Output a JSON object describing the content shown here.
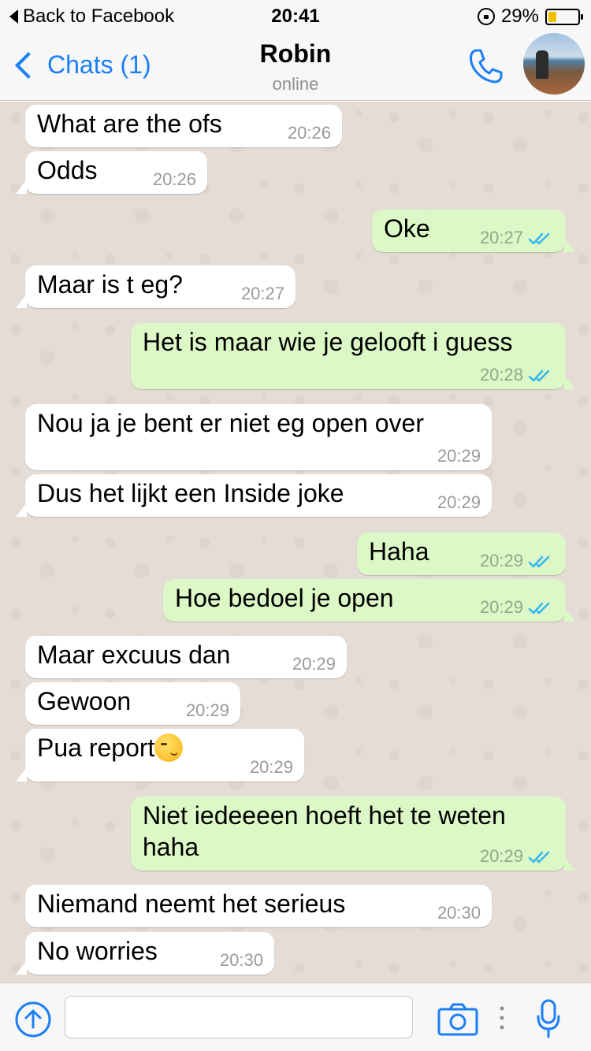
{
  "status_bar": {
    "back_app": "Back to Facebook",
    "time": "20:41",
    "battery": "29%",
    "battery_level": 0.29,
    "battery_color": "#f3c000"
  },
  "nav": {
    "back_label": "Chats (1)",
    "title": "Robin",
    "subtitle": "online",
    "accent": "#1b7ff7",
    "icons": [
      "chevron-left-icon",
      "phone-icon",
      "avatar"
    ]
  },
  "messages": [
    {
      "dir": "in",
      "text": "What are the ofs",
      "time": "20:26"
    },
    {
      "dir": "in",
      "text": "Odds",
      "time": "20:26"
    },
    {
      "dir": "out",
      "text": "Oke",
      "time": "20:27"
    },
    {
      "dir": "in",
      "text": "Maar is t eg?",
      "time": "20:27"
    },
    {
      "dir": "out",
      "text": "Het is maar wie je gelooft i guess",
      "time": "20:28"
    },
    {
      "dir": "in",
      "text": "Nou ja je bent er niet eg open over",
      "time": "20:29"
    },
    {
      "dir": "in",
      "text": "Dus het lijkt een Inside joke",
      "time": "20:29"
    },
    {
      "dir": "out",
      "text": "Haha",
      "time": "20:29"
    },
    {
      "dir": "out",
      "text": "Hoe bedoel je open",
      "time": "20:29"
    },
    {
      "dir": "in",
      "text": "Maar excuus dan",
      "time": "20:29"
    },
    {
      "dir": "in",
      "text": "Gewoon",
      "time": "20:29"
    },
    {
      "dir": "in",
      "text": "Pua report",
      "time": "20:29",
      "emoji": "smirk-emoji"
    },
    {
      "dir": "out",
      "text": "Niet iedeeeen hoeft het te weten",
      "text2": "haha",
      "time": "20:29"
    },
    {
      "dir": "in",
      "text": "Niemand neemt het serieus",
      "time": "20:30"
    },
    {
      "dir": "in",
      "text": "No worries",
      "time": "20:30"
    }
  ],
  "colors": {
    "incoming_bubble": "#ffffff",
    "outgoing_bubble": "#dcf8c6",
    "read_ticks": "#34b7f1",
    "chat_background": "#e5ddd5"
  },
  "input_bar": {
    "placeholder": "",
    "icons": [
      "upload-icon",
      "camera-icon",
      "more-dots-icon",
      "microphone-icon"
    ]
  },
  "scroll_down": {
    "icon": "chevron-down-circle-icon"
  }
}
